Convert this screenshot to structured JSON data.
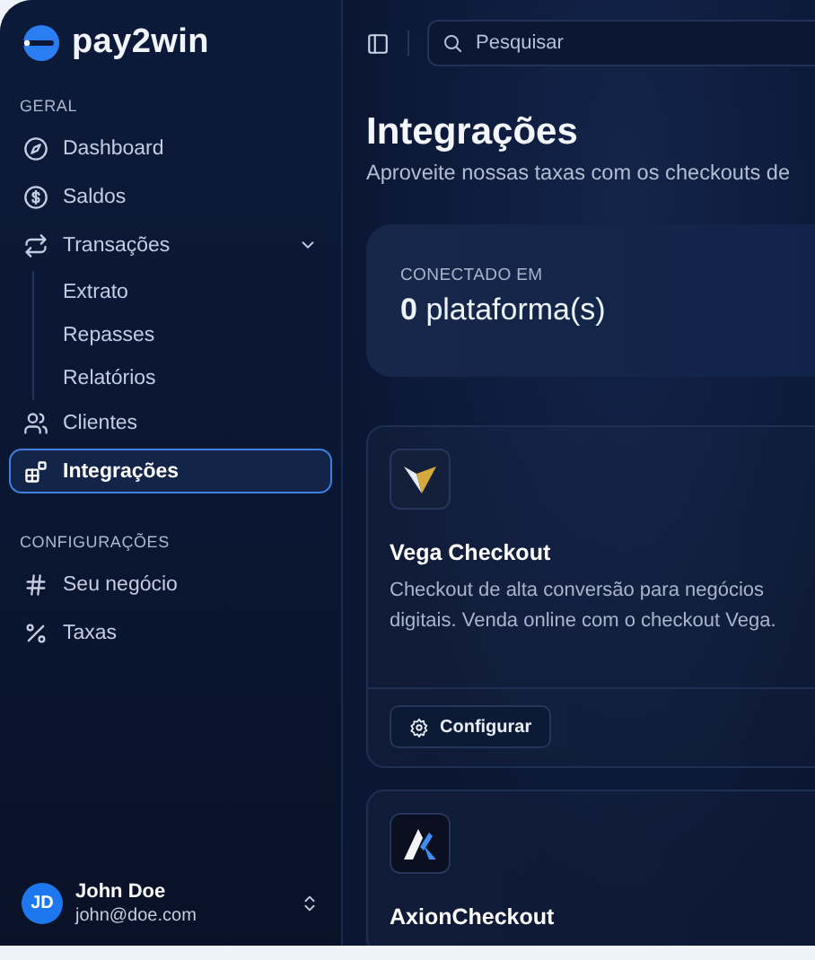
{
  "brand": {
    "name": "pay2win"
  },
  "sidebar": {
    "sections": [
      {
        "title": "GERAL",
        "items": [
          {
            "label": "Dashboard",
            "selected": false
          },
          {
            "label": "Saldos",
            "selected": false
          },
          {
            "label": "Transações",
            "selected": false,
            "expanded": true,
            "children": [
              {
                "label": "Extrato",
                "selected": false
              },
              {
                "label": "Repasses",
                "selected": false
              },
              {
                "label": "Relatórios",
                "selected": false
              }
            ]
          },
          {
            "label": "Clientes",
            "selected": false
          },
          {
            "label": "Integrações",
            "selected": true
          }
        ]
      },
      {
        "title": "CONFIGURAÇÕES",
        "items": [
          {
            "label": "Seu negócio",
            "selected": false
          },
          {
            "label": "Taxas",
            "selected": false
          }
        ]
      }
    ]
  },
  "user": {
    "initials": "JD",
    "name": "John Doe",
    "email": "john@doe.com"
  },
  "search": {
    "placeholder": "Pesquisar"
  },
  "page": {
    "title": "Integrações",
    "subtitle": "Aproveite nossas taxas com os checkouts de"
  },
  "stat": {
    "label": "CONECTADO EM",
    "value": "**0** plataforma(s)"
  },
  "integrations": [
    {
      "name": "Vega Checkout",
      "description": "Checkout de alta conversão para negócios digitais. Venda online com o checkout Vega.",
      "action": "Configurar"
    },
    {
      "name": "AxionCheckout"
    }
  ]
}
